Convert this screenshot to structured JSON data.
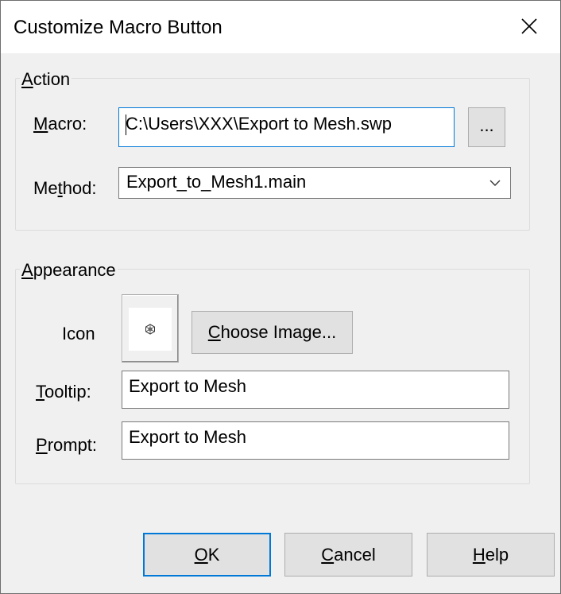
{
  "window": {
    "title": "Customize Macro Button",
    "close_icon": "close-icon"
  },
  "action_group": {
    "label_accel": "A",
    "label_rest": "ction",
    "macro": {
      "label_accel": "M",
      "label_rest": "acro:",
      "value": "C:\\Users\\XXX\\Export to Mesh.swp",
      "browse_label": "..."
    },
    "method": {
      "label_pre": "Me",
      "label_accel": "t",
      "label_rest": "hod:",
      "selected": "Export_to_Mesh1.main",
      "dropdown_icon": "chevron-down-icon"
    }
  },
  "appearance_group": {
    "label_accel": "A",
    "label_rest": "ppearance",
    "icon_label": "Icon",
    "icon_preview": "mesh-icon",
    "choose_image": {
      "accel": "C",
      "rest": "hoose Image..."
    },
    "tooltip": {
      "label_accel": "T",
      "label_rest": "ooltip:",
      "value": "Export to Mesh"
    },
    "prompt": {
      "label_accel": "P",
      "label_rest": "rompt:",
      "value": "Export to Mesh"
    }
  },
  "footer": {
    "ok": {
      "accel": "O",
      "rest": "K"
    },
    "cancel": {
      "accel": "C",
      "rest": "ancel"
    },
    "help": {
      "accel": "H",
      "rest": "elp"
    }
  },
  "colors": {
    "accent": "#0078d7",
    "dialog_bg": "#f0f0f0",
    "button_bg": "#e1e1e1"
  }
}
